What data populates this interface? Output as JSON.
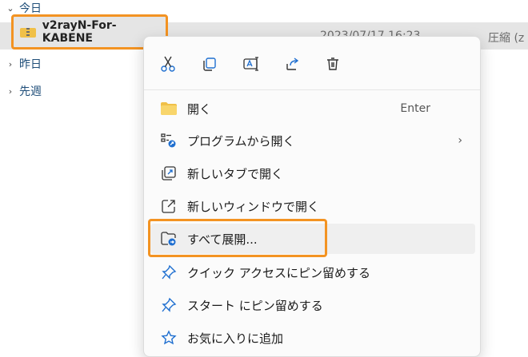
{
  "groups": {
    "today": "今日",
    "yesterday": "昨日",
    "last_week": "先週"
  },
  "file": {
    "name": "v2rayN-For-KABENE",
    "date": "2023/07/17 16:23",
    "type": "圧縮 (z"
  },
  "toolbar": {
    "cut": "scissors-icon",
    "copy": "copy-icon",
    "rename": "rename-icon",
    "share": "share-icon",
    "delete": "trash-icon"
  },
  "menu": {
    "open": {
      "label": "開く",
      "shortcut": "Enter"
    },
    "open_with": {
      "label": "プログラムから開く"
    },
    "open_new_tab": {
      "label": "新しいタブで開く"
    },
    "open_new_window": {
      "label": "新しいウィンドウで開く"
    },
    "extract_all": {
      "label": "すべて展開..."
    },
    "pin_quick_access": {
      "label": "クイック アクセスにピン留めする"
    },
    "pin_start": {
      "label": "スタート にピン留めする"
    },
    "add_favorites": {
      "label": "お気に入りに追加"
    }
  },
  "colors": {
    "highlight": "#f39322",
    "accent": "#1f6fd0",
    "folder": "#f0c048"
  }
}
